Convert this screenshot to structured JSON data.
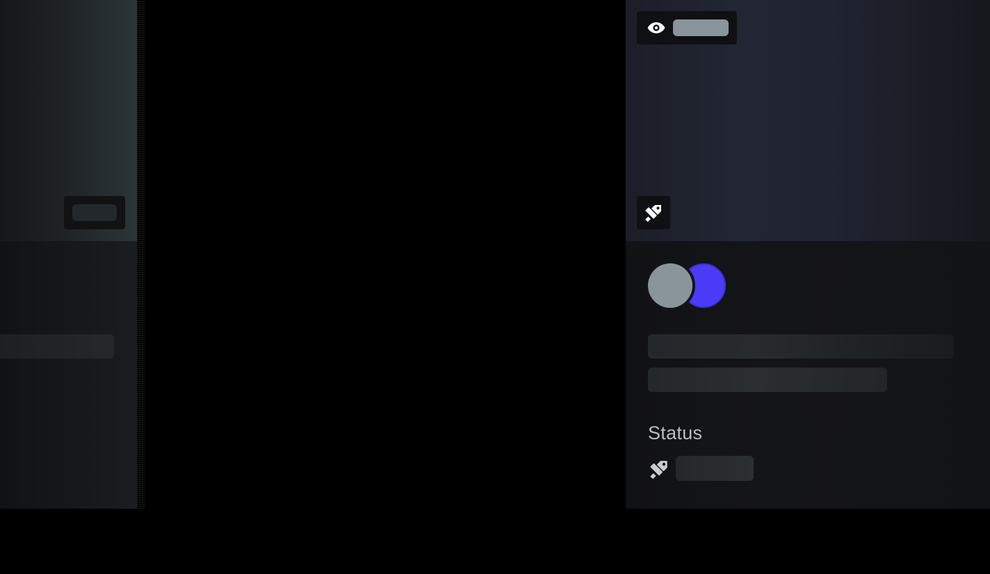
{
  "left_card": {
    "state": "loading-skeleton"
  },
  "right_card": {
    "views_chip": {
      "icon": "eye-icon",
      "value_state": "loading"
    },
    "badge_chip": {
      "icon": "pen-ruler-icon"
    },
    "avatars": [
      {
        "name": "avatar-placeholder",
        "color": "#8a949b"
      },
      {
        "name": "avatar-placeholder",
        "color": "#4a3cf7"
      }
    ],
    "status": {
      "label": "Status",
      "icon": "pen-ruler-icon",
      "value_state": "loading"
    }
  },
  "colors": {
    "background": "#000000",
    "accent": "#4a3cf7",
    "skeleton": "#8a949b",
    "text_muted": "#b8bfc4"
  }
}
